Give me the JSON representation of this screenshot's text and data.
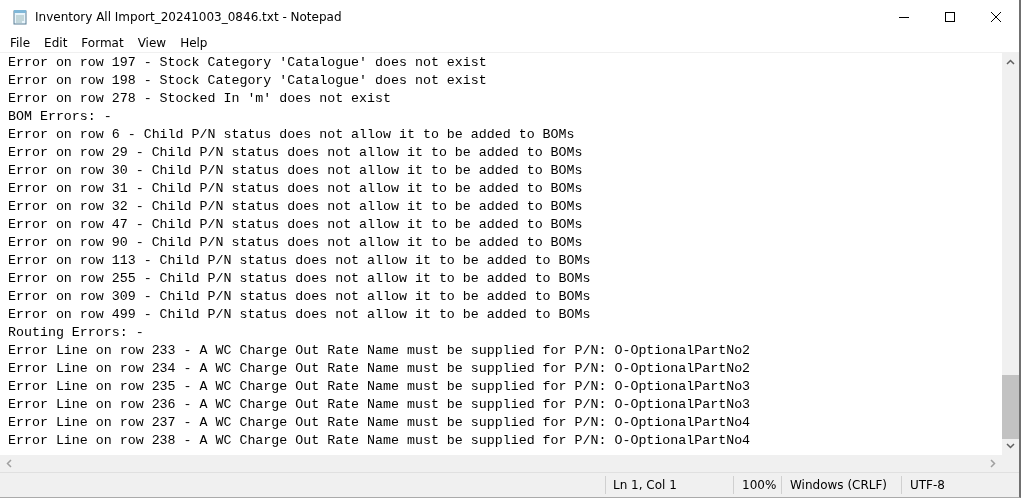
{
  "window": {
    "title": "Inventory All Import_20241003_0846.txt - Notepad"
  },
  "menu": [
    "File",
    "Edit",
    "Format",
    "View",
    "Help"
  ],
  "lines": [
    "Error on row 197 - Stock Category 'Catalogue' does not exist",
    "Error on row 198 - Stock Category 'Catalogue' does not exist",
    "Error on row 278 - Stocked In 'm' does not exist",
    "BOM Errors: -",
    "Error on row 6 - Child P/N status does not allow it to be added to BOMs",
    "Error on row 29 - Child P/N status does not allow it to be added to BOMs",
    "Error on row 30 - Child P/N status does not allow it to be added to BOMs",
    "Error on row 31 - Child P/N status does not allow it to be added to BOMs",
    "Error on row 32 - Child P/N status does not allow it to be added to BOMs",
    "Error on row 47 - Child P/N status does not allow it to be added to BOMs",
    "Error on row 90 - Child P/N status does not allow it to be added to BOMs",
    "Error on row 113 - Child P/N status does not allow it to be added to BOMs",
    "Error on row 255 - Child P/N status does not allow it to be added to BOMs",
    "Error on row 309 - Child P/N status does not allow it to be added to BOMs",
    "Error on row 499 - Child P/N status does not allow it to be added to BOMs",
    "Routing Errors: -",
    "Error Line on row 233 - A WC Charge Out Rate Name must be supplied for P/N: O-OptionalPartNo2",
    "Error Line on row 234 - A WC Charge Out Rate Name must be supplied for P/N: O-OptionalPartNo2",
    "Error Line on row 235 - A WC Charge Out Rate Name must be supplied for P/N: O-OptionalPartNo3",
    "Error Line on row 236 - A WC Charge Out Rate Name must be supplied for P/N: O-OptionalPartNo3",
    "Error Line on row 237 - A WC Charge Out Rate Name must be supplied for P/N: O-OptionalPartNo4",
    "Error Line on row 238 - A WC Charge Out Rate Name must be supplied for P/N: O-OptionalPartNo4"
  ],
  "status_bar": {
    "position": "Ln 1, Col 1",
    "zoom": "100%",
    "line_ending": "Windows (CRLF)",
    "encoding": "UTF-8"
  }
}
